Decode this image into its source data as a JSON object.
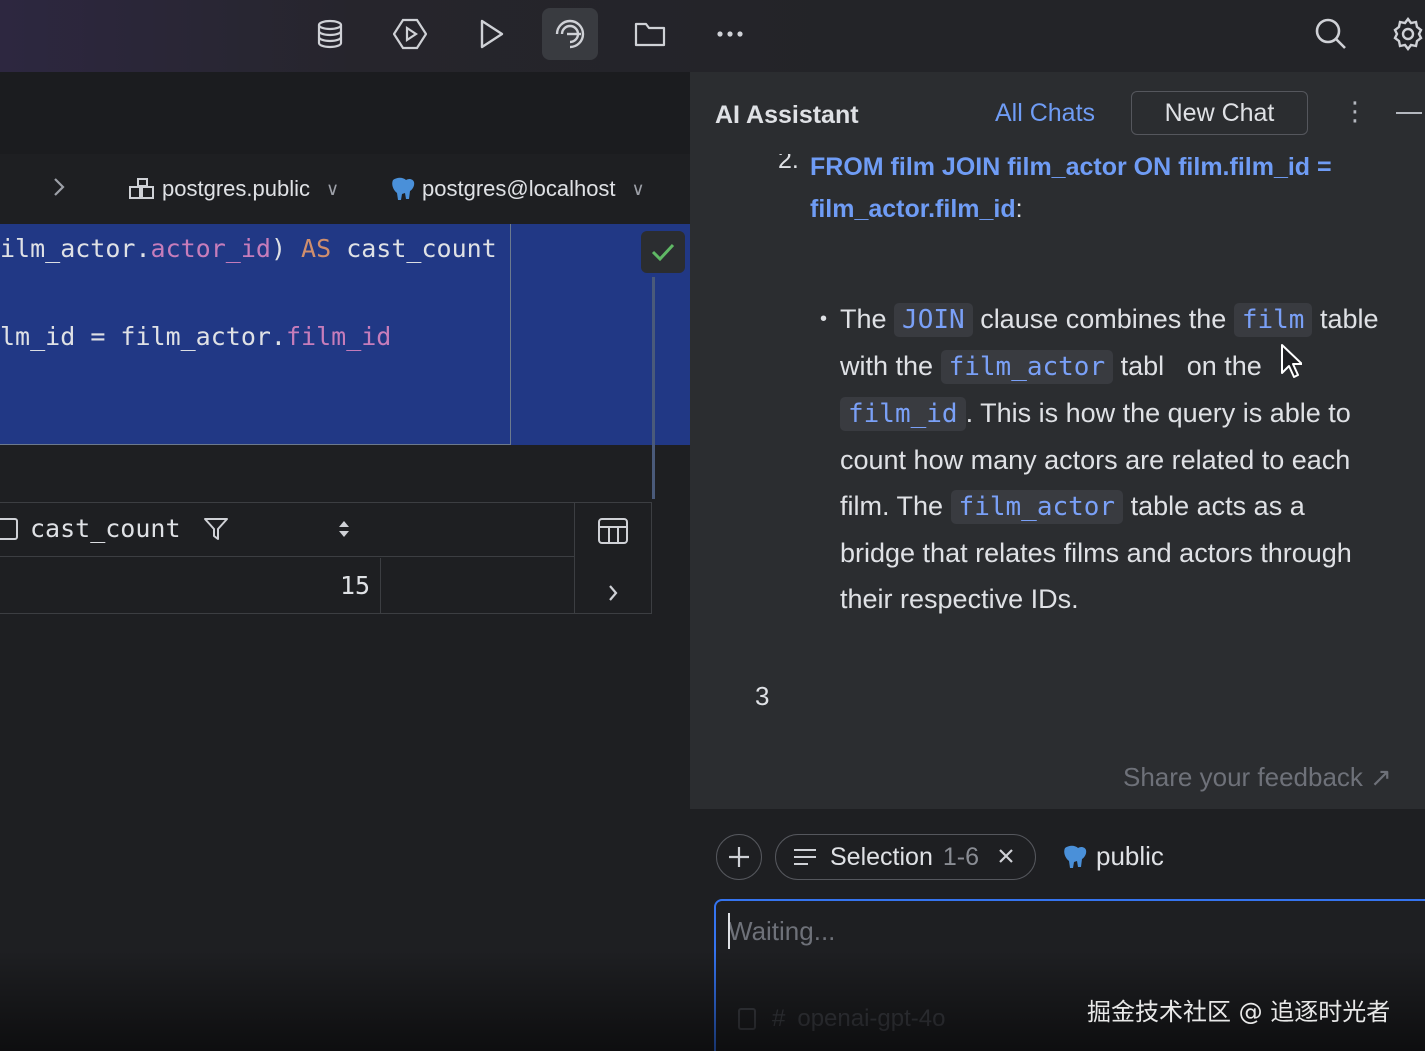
{
  "toolbar": {
    "icons": [
      "database-icon",
      "run-config-icon",
      "run-icon",
      "ai-assistant-icon",
      "folder-icon",
      "more-icon",
      "search-icon",
      "settings-icon"
    ]
  },
  "editor": {
    "breadcrumb": {
      "schema": "postgres.public",
      "datasource": "postgres@localhost"
    },
    "code_lines": [
      {
        "pre": "ilm_actor.",
        "field": "actor_id",
        "mid": ") ",
        "kw": "AS",
        "post": " cast_count"
      },
      {
        "pre": "lm_id",
        "field": "",
        "mid": " = film_actor.",
        "kw": "",
        "post": "film_id",
        "post_is_field": true
      }
    ],
    "results": {
      "column": "cast_count",
      "value": "15"
    }
  },
  "assistant": {
    "title": "AI Assistant",
    "all_chats": "All Chats",
    "new_chat": "New Chat",
    "step_number": "2.",
    "step_text": "FROM film JOIN film_actor ON film.film_id = film_actor.film_id",
    "step_colon": ":",
    "bullet": {
      "t1": "The",
      "c1": "JOIN",
      "t2": "clause combines the",
      "c2": "film",
      "t3": "table with the",
      "c3": "film_actor",
      "t4": "tabl",
      "t4b": "on",
      "t5": "the",
      "c4": "film_id",
      "t6": ". This is how the query is able to count how many actors are related to each film. The",
      "c5": "film_actor",
      "t7": "table acts as a bridge that relates films and actors through their respective IDs."
    },
    "next_number": "3",
    "feedback": "Share your feedback ↗",
    "context": {
      "selection_label": "Selection",
      "selection_range": "1-6",
      "schema_chip": "public"
    },
    "prompt_placeholder": "Waiting...",
    "model": "openai-gpt-4o"
  },
  "watermark": "掘金技术社区 @ 追逐时光者",
  "colors": {
    "accent": "#3574f0",
    "link": "#6f9cf5",
    "selection": "#213885",
    "inline_code": "#7aa0f7"
  }
}
